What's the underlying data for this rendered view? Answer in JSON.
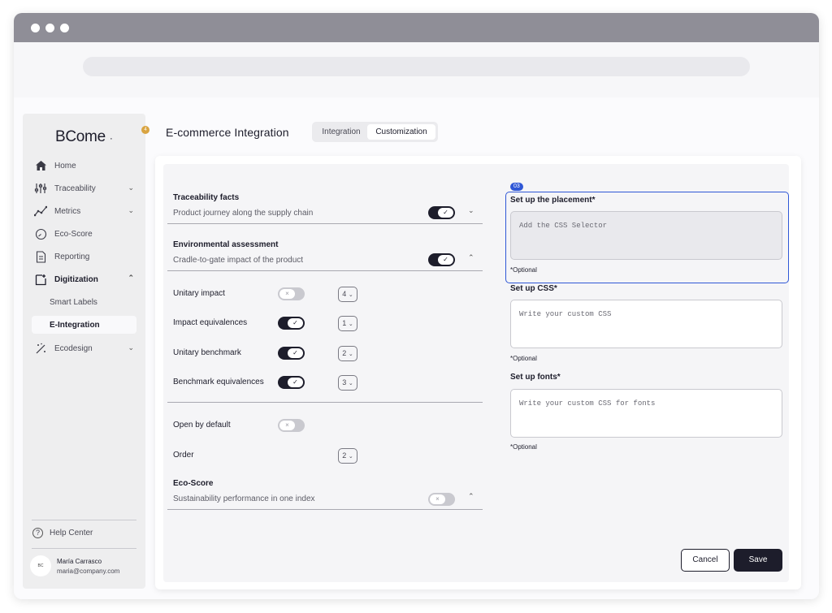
{
  "sidebar": {
    "logo": "BCome",
    "logo_dot": "·",
    "notification_count": "4",
    "items": [
      {
        "label": "Home",
        "icon": "home-icon"
      },
      {
        "label": "Traceability",
        "icon": "sliders-icon"
      },
      {
        "label": "Metrics",
        "icon": "chart-line-icon"
      },
      {
        "label": "Eco-Score",
        "icon": "gauge-icon"
      },
      {
        "label": "Reporting",
        "icon": "document-icon"
      },
      {
        "label": "Digitization",
        "icon": "digitization-icon"
      },
      {
        "label": "Ecodesign",
        "icon": "wand-icon"
      }
    ],
    "sub_items": [
      {
        "label": "Smart Labels"
      },
      {
        "label": "E-Integration"
      }
    ],
    "help": "Help Center",
    "user": {
      "initials": "BC",
      "name": "María Carrasco",
      "email": "maria@company.com"
    }
  },
  "header": {
    "title": "E-commerce Integration",
    "tabs": [
      {
        "label": "Integration"
      },
      {
        "label": "Customization"
      }
    ]
  },
  "left": {
    "traceability": {
      "title": "Traceability facts",
      "subtitle": "Product journey along the supply chain"
    },
    "environmental": {
      "title": "Environmental assessment",
      "subtitle": "Cradle-to-gate impact of the product"
    },
    "rows": [
      {
        "label": "Unitary impact",
        "order": "4"
      },
      {
        "label": "Impact equivalences",
        "order": "1"
      },
      {
        "label": "Unitary benchmark",
        "order": "2"
      },
      {
        "label": "Benchmark equivalences",
        "order": "3"
      }
    ],
    "open_by_default": "Open by default",
    "order_label": "Order",
    "order_value": "2",
    "ecoscore": {
      "title": "Eco-Score",
      "subtitle": "Sustainability performance in one index"
    },
    "check_glyph": "✓",
    "cross_glyph": "×",
    "caret_glyph": "⌄"
  },
  "right": {
    "step": "03",
    "placement": {
      "title": "Set up the placement*",
      "placeholder": "Add the CSS Selector",
      "optional": "*Optional"
    },
    "css": {
      "title": "Set up CSS*",
      "placeholder": "Write your custom CSS",
      "optional": "*Optional"
    },
    "fonts": {
      "title": "Set up fonts*",
      "placeholder": "Write your custom CSS for fonts",
      "optional": "*Optional"
    }
  },
  "actions": {
    "cancel": "Cancel",
    "save": "Save"
  }
}
